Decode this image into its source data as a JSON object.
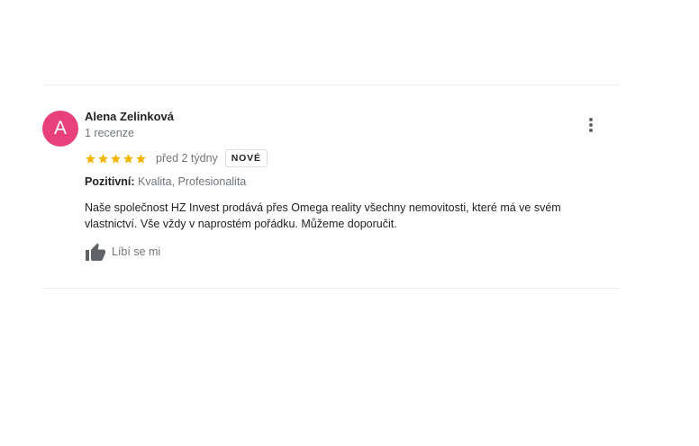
{
  "review": {
    "avatar_letter": "A",
    "avatar_color": "#e8407a",
    "reviewer_name": "Alena Zelinková",
    "review_count": "1 recenze",
    "rating": 5,
    "rating_max": 5,
    "star_color": "#f4b400",
    "time": "před 2 týdny",
    "badge": "NOVÉ",
    "attributes_label": "Pozitivní:",
    "attributes_value": "Kvalita, Profesionalita",
    "text": "Naše společnost HZ Invest prodává přes Omega reality všechny nemovitosti, které má ve svém vlastnictví. Vše vždy v naprostém pořádku. Můžeme doporučit.",
    "like_label": "Líbí se mi",
    "more_icon": "more-vert-icon",
    "like_icon": "thumbs-up-icon"
  }
}
